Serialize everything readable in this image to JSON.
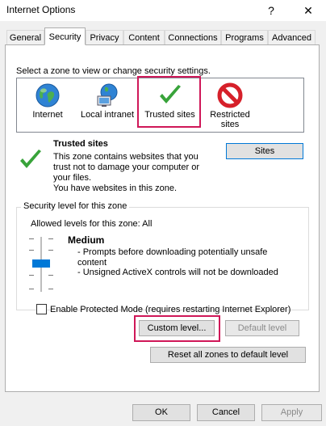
{
  "window": {
    "title": "Internet Options",
    "help": "?",
    "close": "✕"
  },
  "tabs": [
    {
      "label": "General",
      "active": false
    },
    {
      "label": "Security",
      "active": true
    },
    {
      "label": "Privacy",
      "active": false
    },
    {
      "label": "Content",
      "active": false
    },
    {
      "label": "Connections",
      "active": false
    },
    {
      "label": "Programs",
      "active": false
    },
    {
      "label": "Advanced",
      "active": false
    }
  ],
  "zones": {
    "instruction": "Select a zone to view or change security settings.",
    "items": [
      {
        "label": "Internet",
        "icon": "globe-icon"
      },
      {
        "label": "Local intranet",
        "icon": "intranet-icon"
      },
      {
        "label": "Trusted sites",
        "icon": "checkmark-icon",
        "selected": true
      },
      {
        "label": "Restricted sites",
        "icon": "no-entry-icon"
      }
    ]
  },
  "description": {
    "title": "Trusted sites",
    "text": "This zone contains websites that you trust not to damage your computer or your files.\nYou have websites in this zone.",
    "sites_button": "Sites"
  },
  "security_level": {
    "group_label": "Security level for this zone",
    "allowed_label": "Allowed levels for this zone: All",
    "level_name": "Medium",
    "level_desc1": "- Prompts before downloading potentially unsafe content",
    "level_desc2": "- Unsigned ActiveX controls will not be downloaded",
    "protected_mode": "Enable Protected Mode (requires restarting Internet Explorer)",
    "protected_mode_checked": false,
    "custom_button": "Custom level...",
    "default_button": "Default level",
    "reset_button": "Reset all zones to default level"
  },
  "footer": {
    "ok": "OK",
    "cancel": "Cancel",
    "apply": "Apply"
  },
  "colors": {
    "accent": "#0078d7",
    "highlight": "#cf1758",
    "check_green": "#38a33a",
    "restricted_red": "#d6202a"
  }
}
